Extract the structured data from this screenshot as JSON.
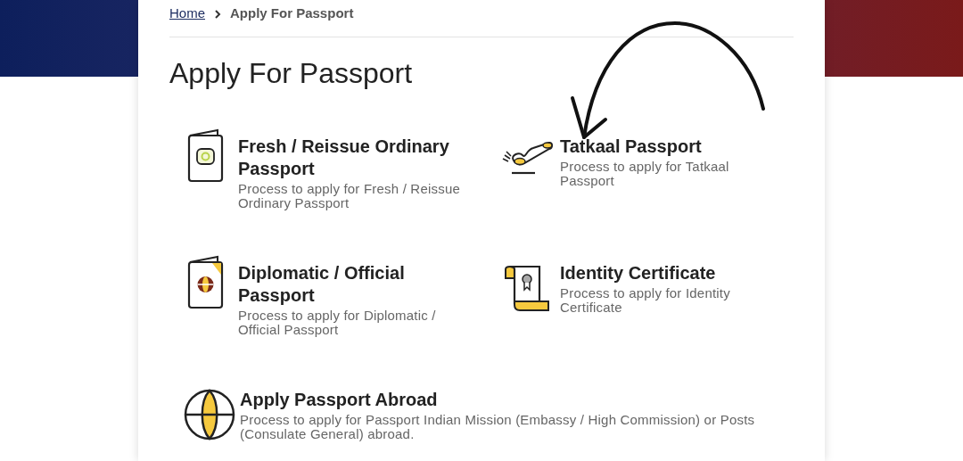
{
  "breadcrumb": [
    {
      "label": "Home",
      "kind": "link"
    },
    {
      "label": "Apply For Passport",
      "kind": "current"
    }
  ],
  "title": "Apply For Passport",
  "services": [
    {
      "kind": "passport",
      "title": "Fresh / Reissue Ordinary Passport",
      "description": "Process to apply for Fresh / Reissue Ordinary Passport"
    },
    {
      "kind": "plane",
      "title": "Tatkaal Passport",
      "description": "Process to apply for Tatkaal Passport"
    },
    {
      "kind": "diplomatic",
      "title": "Diplomatic / Official Passport",
      "description": "Process to apply for Diplomatic / Official Passport"
    },
    {
      "kind": "certificate",
      "title": "Identity Certificate",
      "description": "Process to apply for Identity Certificate"
    },
    {
      "kind": "globe",
      "title": "Apply Passport Abroad",
      "description": "Process to apply for Passport Indian Mission (Embassy / High Commission) or Posts (Consulate General) abroad."
    }
  ]
}
